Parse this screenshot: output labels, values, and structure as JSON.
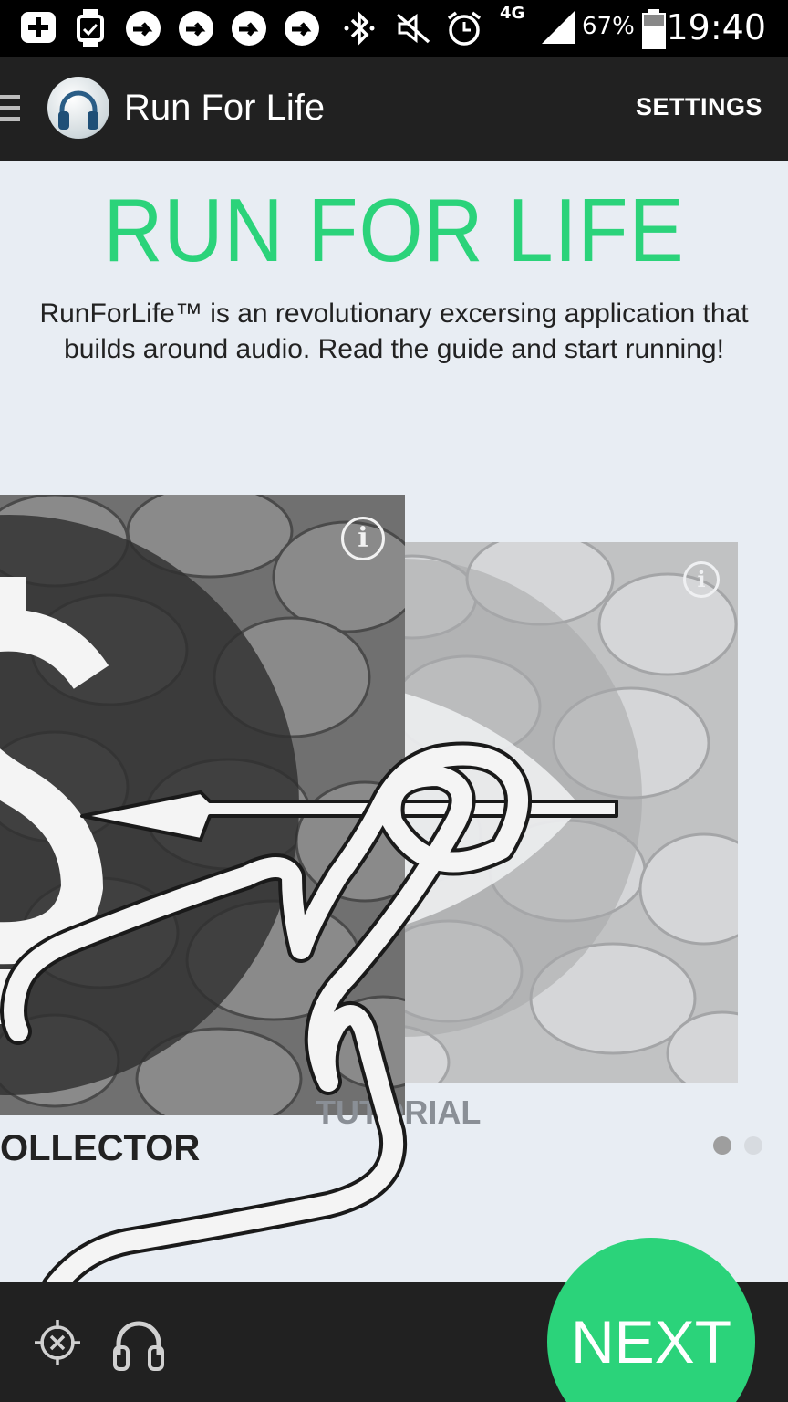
{
  "status_bar": {
    "network": "4G",
    "battery": "67%",
    "time": "19:40"
  },
  "app_bar": {
    "title": "Run For Life",
    "settings_label": "SETTINGS"
  },
  "main": {
    "hero_title": "RUN FOR LIFE",
    "intro_text": "RunForLife™ is an revolutionary excersing application that builds around audio. Read the guide and start running!"
  },
  "cards": [
    {
      "label": "OLLECTOR",
      "info": "i"
    },
    {
      "label": "TUTORIAL",
      "info": "i"
    }
  ],
  "pager": {
    "pages": 2,
    "current": 1
  },
  "bottom_bar": {
    "next_label": "NEXT"
  },
  "colors": {
    "accent": "#2bd37a",
    "bar": "#212121",
    "background": "#e8edf3"
  }
}
